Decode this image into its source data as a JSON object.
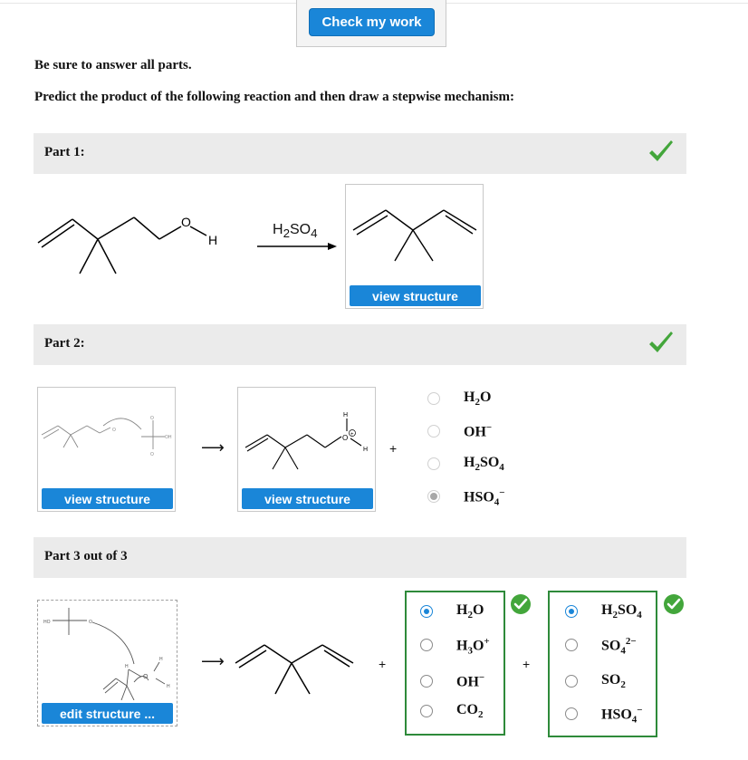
{
  "header": {
    "check_label": "Check my work"
  },
  "instructions": {
    "line1": "Be sure to answer all parts.",
    "line2": "Predict the product of the following reaction and then draw a stepwise mechanism:"
  },
  "part1": {
    "label": "Part 1:",
    "reagent_main": "H",
    "reagent_sub": "2",
    "reagent_tail": "SO",
    "reagent_sub2": "4",
    "atom_o": "O",
    "atom_h": "H",
    "view_label": "view structure"
  },
  "part2": {
    "label": "Part 2:",
    "view_label_1": "view structure",
    "view_label_2": "view structure",
    "plus": "+",
    "options": [
      {
        "main": "H",
        "sub": "2",
        "tail": "O",
        "sup": "",
        "selected": false
      },
      {
        "main": "OH",
        "sub": "",
        "tail": "",
        "sup": "−",
        "selected": false
      },
      {
        "main": "H",
        "sub": "2",
        "tail": "SO",
        "sub2": "4",
        "sup": "",
        "selected": false
      },
      {
        "main": "HSO",
        "sub": "4",
        "tail": "",
        "sup": "−",
        "selected": true
      }
    ]
  },
  "part3": {
    "label": "Part 3 out of 3",
    "edit_label": "edit structure ...",
    "plus1": "+",
    "plus2": "+",
    "group1": [
      {
        "main": "H",
        "sub": "2",
        "tail": "O",
        "sup": "",
        "selected": true
      },
      {
        "main": "H",
        "sub": "3",
        "tail": "O",
        "sup": "+",
        "selected": false
      },
      {
        "main": "OH",
        "sub": "",
        "tail": "",
        "sup": "−",
        "selected": false
      },
      {
        "main": "CO",
        "sub": "2",
        "tail": "",
        "sup": "",
        "selected": false
      }
    ],
    "group2": [
      {
        "main": "H",
        "sub": "2",
        "tail": "SO",
        "sub2": "4",
        "sup": "",
        "selected": true
      },
      {
        "main": "SO",
        "sub": "4",
        "tail": "",
        "sup": "2−",
        "selected": false
      },
      {
        "main": "SO",
        "sub": "2",
        "tail": "",
        "sup": "",
        "selected": false
      },
      {
        "main": "HSO",
        "sub": "4",
        "tail": "",
        "sup": "−",
        "selected": false
      }
    ]
  },
  "colors": {
    "accent": "#1a86d8",
    "success": "#2e8a3a",
    "check": "#43a63b"
  }
}
